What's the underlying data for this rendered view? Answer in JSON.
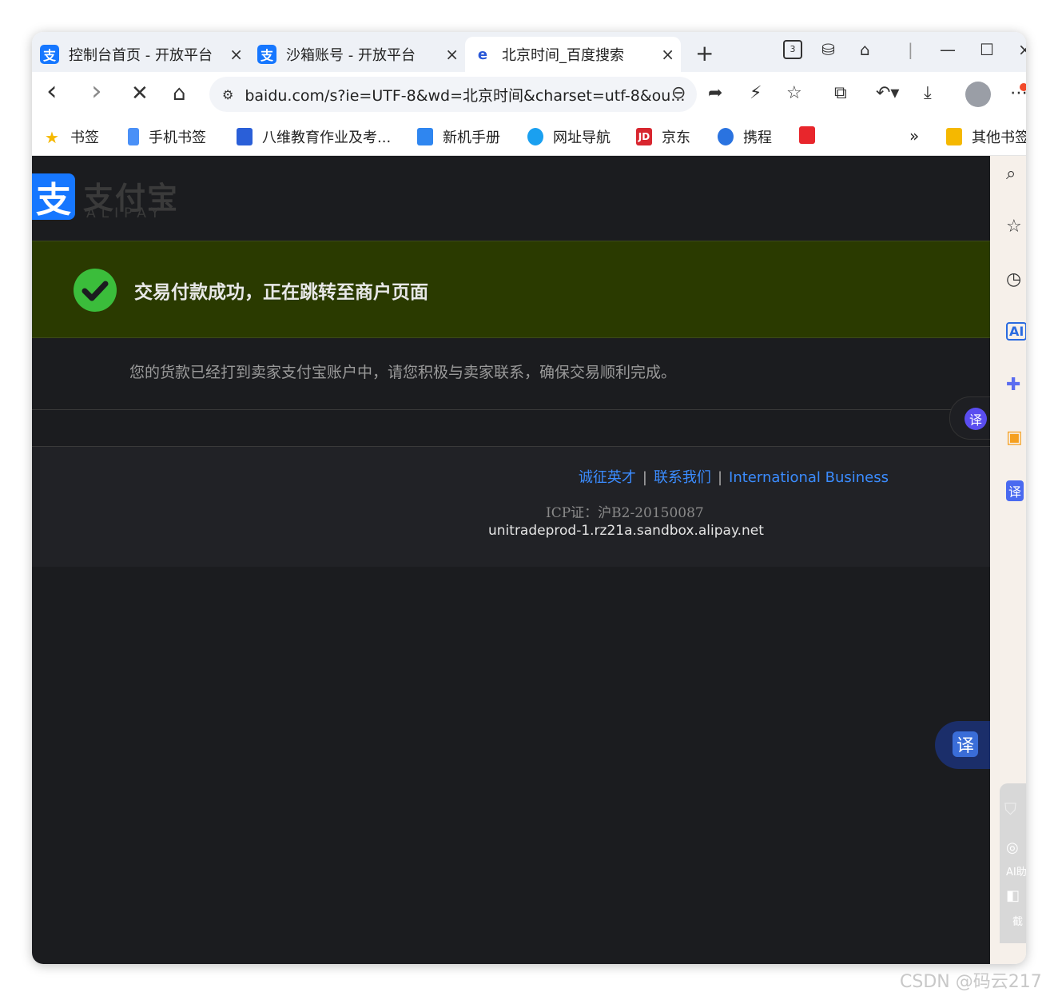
{
  "tabs": [
    {
      "label": "控制台首页 - 开放平台",
      "favicon": "支",
      "icon": "alipay-icon"
    },
    {
      "label": "沙箱账号 - 开放平台",
      "favicon": "支",
      "icon": "alipay-icon"
    },
    {
      "label": "北京时间_百度搜索",
      "favicon": "e",
      "icon": "browser-icon"
    }
  ],
  "tab_close": "×",
  "new_tab": "+",
  "window_controls": {
    "tab_count": "3",
    "minimize": "—",
    "maximize": "☐",
    "close": "×"
  },
  "nav": {
    "back": "‹",
    "forward": "›",
    "stop": "✕",
    "home": "⌂"
  },
  "address": {
    "url": "baidu.com/s?ie=UTF-8&wd=北京时间&charset=utf-8&ou..."
  },
  "bookmarks": [
    {
      "label": "书签",
      "color": "#f5b800"
    },
    {
      "label": "手机书签",
      "color": "#4a90f7"
    },
    {
      "label": "八维教育作业及考...",
      "color": "#2a5fd8"
    },
    {
      "label": "新机手册",
      "color": "#2f86f0"
    },
    {
      "label": "网址导航",
      "color": "#1aa0f0"
    },
    {
      "label": "京东",
      "color": "#d8262f"
    },
    {
      "label": "携程",
      "color": "#2a73e0"
    },
    {
      "label": "",
      "color": "#e8262c"
    }
  ],
  "bookmarks_more": "»",
  "other_bookmarks": "其他书签",
  "page": {
    "logo_cn": "支付宝",
    "logo_en": "ALIPAY",
    "logo_mark": "支",
    "success_message": "交易付款成功，正在跳转至商户页面",
    "sub_message": "您的货款已经打到卖家支付宝账户中，请您积极与卖家联系，确保交易顺利完成。",
    "footer_links": [
      "诚征英才",
      "联系我们",
      "International Business"
    ],
    "footer_sep": "|",
    "icp": "ICP证：沪B2-20150087",
    "host": "unitradeprod-1.rz21a.sandbox.alipay.net",
    "translate_label": "译"
  },
  "side_panel": {
    "ai_label": "AI",
    "translate_label": "译",
    "ai_assist_label": "AI助",
    "screenshot_label": "截"
  },
  "watermark": "CSDN @码云217",
  "colors": {
    "success_bg": "#2a3a00",
    "check": "#3bbd3b",
    "link": "#3b8cff",
    "alipay_blue": "#1677ff",
    "content_bg": "#1b1c1f"
  }
}
